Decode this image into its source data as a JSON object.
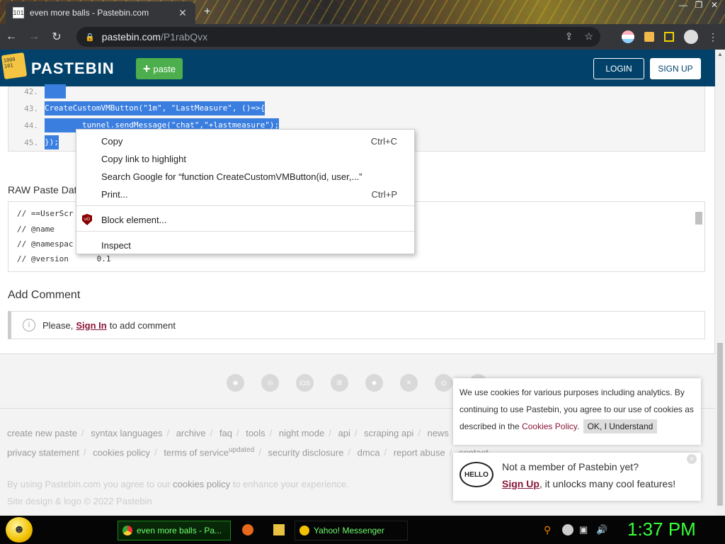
{
  "browser": {
    "tab_title": "even more balls - Pastebin.com",
    "favicon_text": "101",
    "url_host": "pastebin.com",
    "url_path": "/P1rabQvx"
  },
  "header": {
    "logo_text": "1000 101",
    "brand": "PASTEBIN",
    "paste_button": "paste",
    "login_button": "LOGIN",
    "signup_button": "SIGN UP"
  },
  "code": {
    "lines": [
      {
        "num": "42.",
        "text": ""
      },
      {
        "num": "43.",
        "text": "CreateCustomVMButton(\"1m\", \"LastMeasure\", ()=>{"
      },
      {
        "num": "44.",
        "text": "        tunnel.sendMessage(\"chat\",\"+lastmeasure\");"
      },
      {
        "num": "45.",
        "text": "});"
      }
    ]
  },
  "raw": {
    "title": "RAW Paste Dat",
    "lines": [
      "// ==UserScr",
      "// @name",
      "// @namespac",
      "// @version      0.1"
    ]
  },
  "comments": {
    "title": "Add Comment",
    "prompt_pre": "Please,",
    "sign_in": "Sign In",
    "prompt_post": "to add comment"
  },
  "context_menu": {
    "copy": "Copy",
    "copy_shortcut": "Ctrl+C",
    "copy_link": "Copy link to highlight",
    "search_google": "Search Google for “function CreateCustomVMButton(id, user,...”",
    "print": "Print...",
    "print_shortcut": "Ctrl+P",
    "block_element": "Block element...",
    "inspect": "Inspect",
    "ublock_badge": "uO"
  },
  "footer": {
    "app_icons": [
      "chrome-icon",
      "firefox-icon",
      "ios-icon",
      "windows-icon",
      "android-icon",
      "mac-icon",
      "opera-icon",
      "other-icon"
    ],
    "ios_label": "iOS",
    "links_row1": [
      "create new paste",
      "syntax languages",
      "archive",
      "faq",
      "tools",
      "night mode",
      "api",
      "scraping api",
      "news"
    ],
    "links_row2": [
      "privacy statement",
      "cookies policy",
      "terms of service",
      "security disclosure",
      "dmca",
      "report abuse",
      "contact"
    ],
    "tos_sup": "updated",
    "note_pre": "By using Pastebin.com you agree to our",
    "note_link": "cookies policy",
    "note_post": "to enhance your experience.",
    "copyright": "Site design & logo © 2022 Pastebin"
  },
  "cookie_popup": {
    "text": "We use cookies for various purposes including analytics. By continuing to use Pastebin, you agree to our use of cookies as described in the",
    "link": "Cookies Policy",
    "period": ".",
    "button": "OK, I Understand"
  },
  "member_popup": {
    "hello": "HELLO",
    "question": "Not a member of Pastebin yet?",
    "signup": "Sign Up",
    "rest": ", it unlocks many cool features!",
    "close": "×"
  },
  "taskbar": {
    "task1": "even more balls - Pa...",
    "task2": "Yahoo! Messenger",
    "clock": "1:37 PM"
  },
  "colors": {
    "header_bg": "#02426a",
    "paste_green": "#4cae4c",
    "link_maroon": "#8a1538",
    "selection_blue": "#3a7ee0",
    "clock_green": "#39ff39"
  }
}
